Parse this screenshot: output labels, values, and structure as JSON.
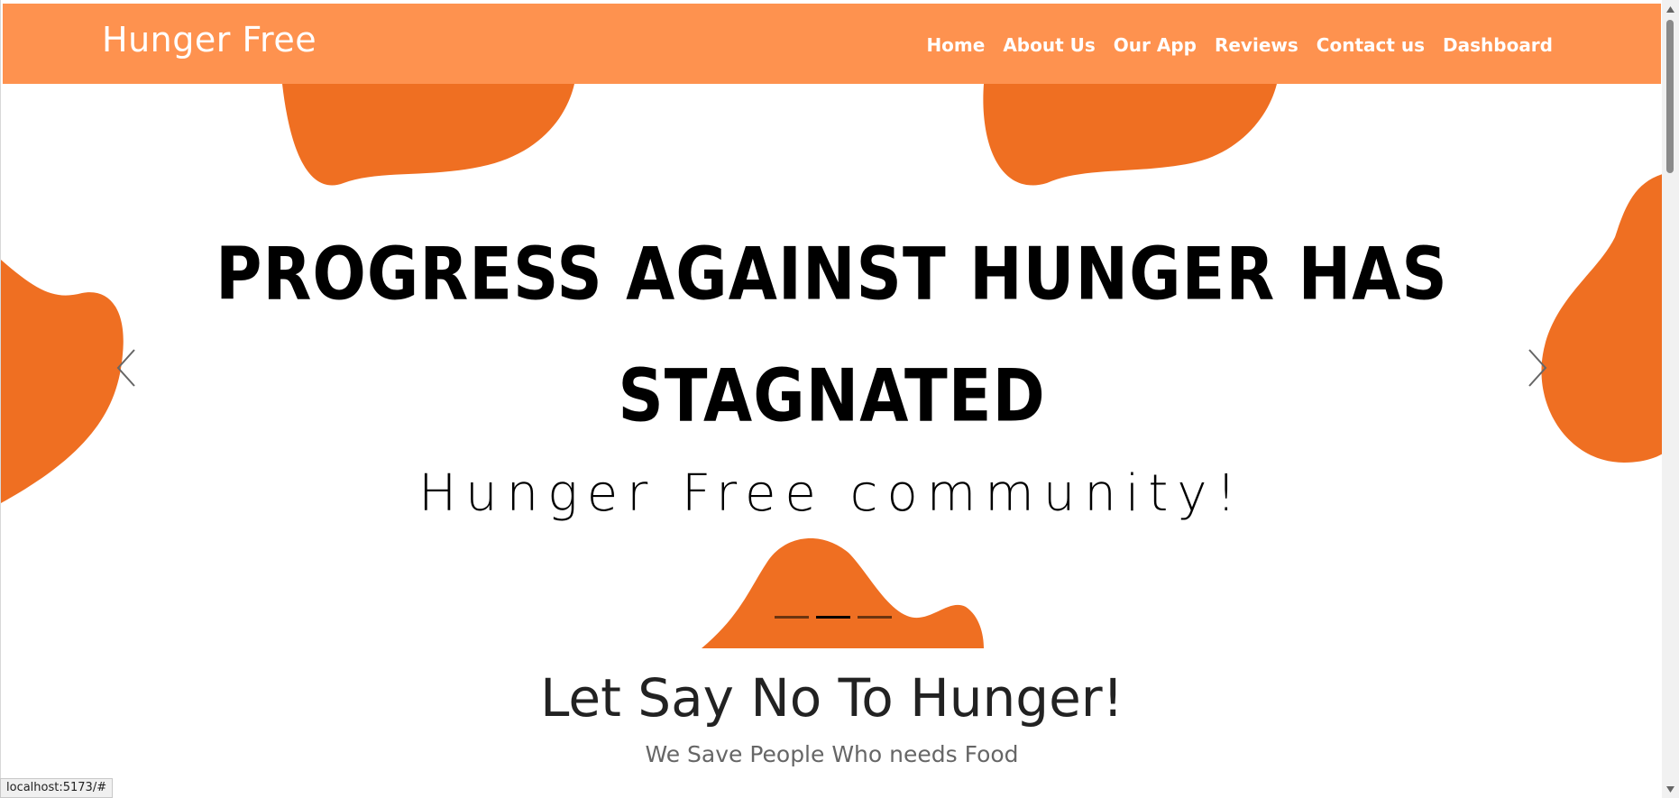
{
  "navbar": {
    "brand": "Hunger Free",
    "links": [
      "Home",
      "About Us",
      "Our App",
      "Reviews",
      "Contact us",
      "Dashboard"
    ]
  },
  "hero": {
    "headline_line1": "PROGRESS AGAINST HUNGER HAS",
    "headline_line2": "STAGNATED",
    "subtitle": "Hunger Free community!",
    "active_slide_index": 1,
    "slide_count": 3,
    "colors": {
      "blob": "#ef6f22"
    }
  },
  "section": {
    "title": "Let Say No To Hunger!",
    "subtitle": "We Save People Who needs Food"
  },
  "status_bar": {
    "url": "localhost:5173/#"
  },
  "theme": {
    "navbar": "#fe924f",
    "accent": "#ef6f22"
  },
  "icons": {
    "prev": "chevron-left-icon",
    "next": "chevron-right-icon"
  }
}
